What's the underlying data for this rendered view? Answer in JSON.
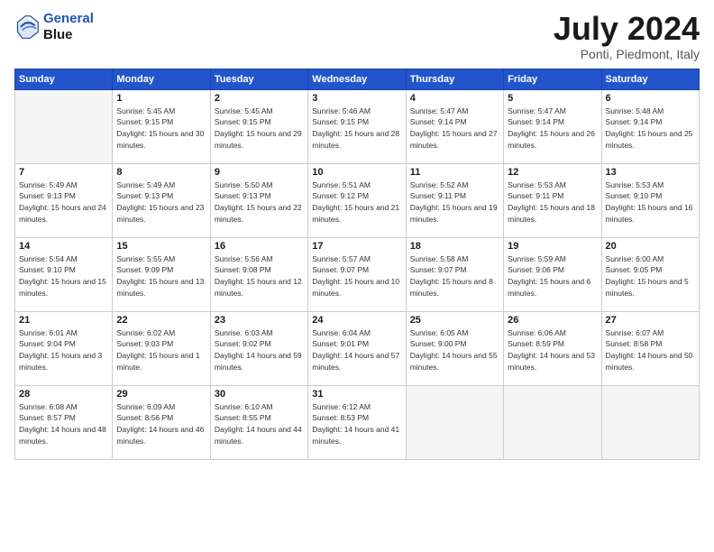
{
  "header": {
    "logo_line1": "General",
    "logo_line2": "Blue",
    "month_year": "July 2024",
    "location": "Ponti, Piedmont, Italy"
  },
  "weekdays": [
    "Sunday",
    "Monday",
    "Tuesday",
    "Wednesday",
    "Thursday",
    "Friday",
    "Saturday"
  ],
  "weeks": [
    [
      {
        "day": "",
        "sunrise": "",
        "sunset": "",
        "daylight": ""
      },
      {
        "day": "1",
        "sunrise": "Sunrise: 5:45 AM",
        "sunset": "Sunset: 9:15 PM",
        "daylight": "Daylight: 15 hours and 30 minutes."
      },
      {
        "day": "2",
        "sunrise": "Sunrise: 5:45 AM",
        "sunset": "Sunset: 9:15 PM",
        "daylight": "Daylight: 15 hours and 29 minutes."
      },
      {
        "day": "3",
        "sunrise": "Sunrise: 5:46 AM",
        "sunset": "Sunset: 9:15 PM",
        "daylight": "Daylight: 15 hours and 28 minutes."
      },
      {
        "day": "4",
        "sunrise": "Sunrise: 5:47 AM",
        "sunset": "Sunset: 9:14 PM",
        "daylight": "Daylight: 15 hours and 27 minutes."
      },
      {
        "day": "5",
        "sunrise": "Sunrise: 5:47 AM",
        "sunset": "Sunset: 9:14 PM",
        "daylight": "Daylight: 15 hours and 26 minutes."
      },
      {
        "day": "6",
        "sunrise": "Sunrise: 5:48 AM",
        "sunset": "Sunset: 9:14 PM",
        "daylight": "Daylight: 15 hours and 25 minutes."
      }
    ],
    [
      {
        "day": "7",
        "sunrise": "Sunrise: 5:49 AM",
        "sunset": "Sunset: 9:13 PM",
        "daylight": "Daylight: 15 hours and 24 minutes."
      },
      {
        "day": "8",
        "sunrise": "Sunrise: 5:49 AM",
        "sunset": "Sunset: 9:13 PM",
        "daylight": "Daylight: 15 hours and 23 minutes."
      },
      {
        "day": "9",
        "sunrise": "Sunrise: 5:50 AM",
        "sunset": "Sunset: 9:13 PM",
        "daylight": "Daylight: 15 hours and 22 minutes."
      },
      {
        "day": "10",
        "sunrise": "Sunrise: 5:51 AM",
        "sunset": "Sunset: 9:12 PM",
        "daylight": "Daylight: 15 hours and 21 minutes."
      },
      {
        "day": "11",
        "sunrise": "Sunrise: 5:52 AM",
        "sunset": "Sunset: 9:11 PM",
        "daylight": "Daylight: 15 hours and 19 minutes."
      },
      {
        "day": "12",
        "sunrise": "Sunrise: 5:53 AM",
        "sunset": "Sunset: 9:11 PM",
        "daylight": "Daylight: 15 hours and 18 minutes."
      },
      {
        "day": "13",
        "sunrise": "Sunrise: 5:53 AM",
        "sunset": "Sunset: 9:10 PM",
        "daylight": "Daylight: 15 hours and 16 minutes."
      }
    ],
    [
      {
        "day": "14",
        "sunrise": "Sunrise: 5:54 AM",
        "sunset": "Sunset: 9:10 PM",
        "daylight": "Daylight: 15 hours and 15 minutes."
      },
      {
        "day": "15",
        "sunrise": "Sunrise: 5:55 AM",
        "sunset": "Sunset: 9:09 PM",
        "daylight": "Daylight: 15 hours and 13 minutes."
      },
      {
        "day": "16",
        "sunrise": "Sunrise: 5:56 AM",
        "sunset": "Sunset: 9:08 PM",
        "daylight": "Daylight: 15 hours and 12 minutes."
      },
      {
        "day": "17",
        "sunrise": "Sunrise: 5:57 AM",
        "sunset": "Sunset: 9:07 PM",
        "daylight": "Daylight: 15 hours and 10 minutes."
      },
      {
        "day": "18",
        "sunrise": "Sunrise: 5:58 AM",
        "sunset": "Sunset: 9:07 PM",
        "daylight": "Daylight: 15 hours and 8 minutes."
      },
      {
        "day": "19",
        "sunrise": "Sunrise: 5:59 AM",
        "sunset": "Sunset: 9:06 PM",
        "daylight": "Daylight: 15 hours and 6 minutes."
      },
      {
        "day": "20",
        "sunrise": "Sunrise: 6:00 AM",
        "sunset": "Sunset: 9:05 PM",
        "daylight": "Daylight: 15 hours and 5 minutes."
      }
    ],
    [
      {
        "day": "21",
        "sunrise": "Sunrise: 6:01 AM",
        "sunset": "Sunset: 9:04 PM",
        "daylight": "Daylight: 15 hours and 3 minutes."
      },
      {
        "day": "22",
        "sunrise": "Sunrise: 6:02 AM",
        "sunset": "Sunset: 9:03 PM",
        "daylight": "Daylight: 15 hours and 1 minute."
      },
      {
        "day": "23",
        "sunrise": "Sunrise: 6:03 AM",
        "sunset": "Sunset: 9:02 PM",
        "daylight": "Daylight: 14 hours and 59 minutes."
      },
      {
        "day": "24",
        "sunrise": "Sunrise: 6:04 AM",
        "sunset": "Sunset: 9:01 PM",
        "daylight": "Daylight: 14 hours and 57 minutes."
      },
      {
        "day": "25",
        "sunrise": "Sunrise: 6:05 AM",
        "sunset": "Sunset: 9:00 PM",
        "daylight": "Daylight: 14 hours and 55 minutes."
      },
      {
        "day": "26",
        "sunrise": "Sunrise: 6:06 AM",
        "sunset": "Sunset: 8:59 PM",
        "daylight": "Daylight: 14 hours and 53 minutes."
      },
      {
        "day": "27",
        "sunrise": "Sunrise: 6:07 AM",
        "sunset": "Sunset: 8:58 PM",
        "daylight": "Daylight: 14 hours and 50 minutes."
      }
    ],
    [
      {
        "day": "28",
        "sunrise": "Sunrise: 6:08 AM",
        "sunset": "Sunset: 8:57 PM",
        "daylight": "Daylight: 14 hours and 48 minutes."
      },
      {
        "day": "29",
        "sunrise": "Sunrise: 6:09 AM",
        "sunset": "Sunset: 8:56 PM",
        "daylight": "Daylight: 14 hours and 46 minutes."
      },
      {
        "day": "30",
        "sunrise": "Sunrise: 6:10 AM",
        "sunset": "Sunset: 8:55 PM",
        "daylight": "Daylight: 14 hours and 44 minutes."
      },
      {
        "day": "31",
        "sunrise": "Sunrise: 6:12 AM",
        "sunset": "Sunset: 8:53 PM",
        "daylight": "Daylight: 14 hours and 41 minutes."
      },
      {
        "day": "",
        "sunrise": "",
        "sunset": "",
        "daylight": ""
      },
      {
        "day": "",
        "sunrise": "",
        "sunset": "",
        "daylight": ""
      },
      {
        "day": "",
        "sunrise": "",
        "sunset": "",
        "daylight": ""
      }
    ]
  ]
}
